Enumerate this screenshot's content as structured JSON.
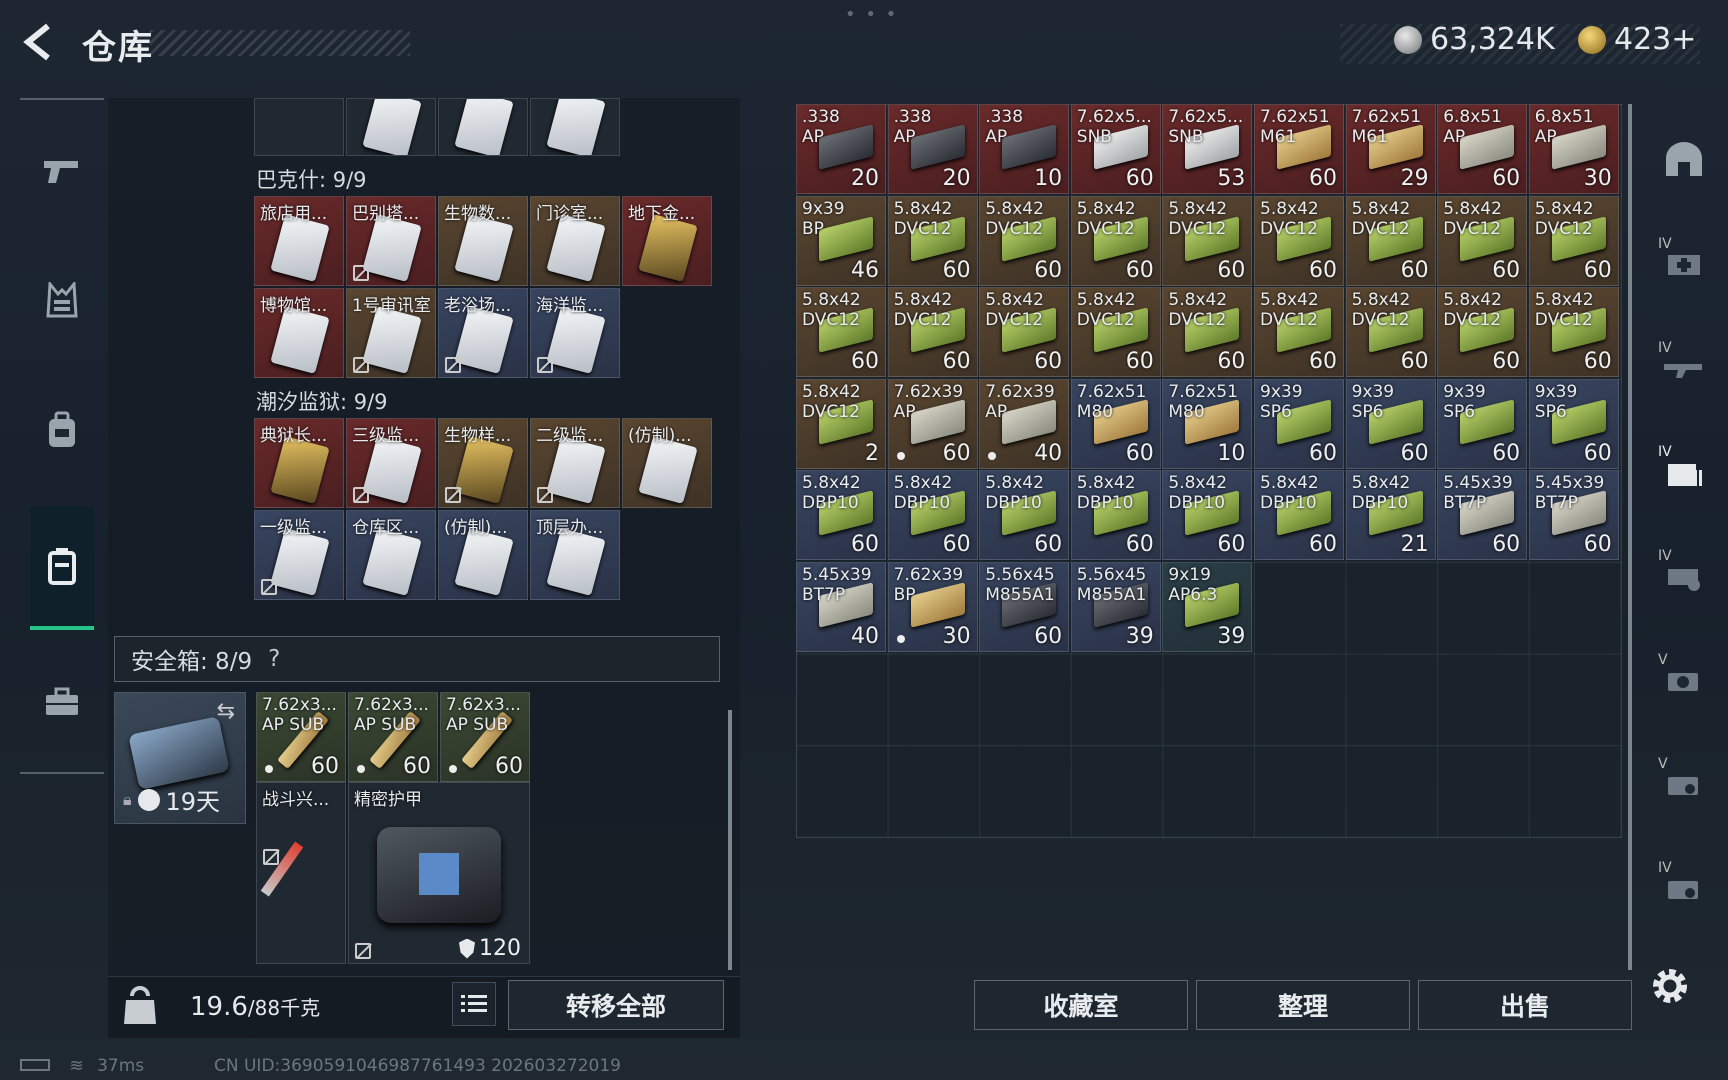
{
  "header": {
    "title": "仓库",
    "currency_primary": "63,324K",
    "currency_secondary": "423+"
  },
  "left_nav": {
    "items": [
      {
        "icon": "pistol-icon"
      },
      {
        "icon": "vest-icon"
      },
      {
        "icon": "backpack-icon"
      },
      {
        "icon": "container-icon",
        "active": true
      },
      {
        "icon": "briefcase-icon"
      }
    ]
  },
  "keycards": {
    "section1_label": "巴克什: 9/9",
    "section1": [
      {
        "name": "旅店用...",
        "color": "red",
        "locked": false
      },
      {
        "name": "巴别塔...",
        "color": "red",
        "locked": true
      },
      {
        "name": "生物数...",
        "color": "brown",
        "locked": false
      },
      {
        "name": "门诊室...",
        "color": "brown",
        "locked": false
      },
      {
        "name": "地下金...",
        "color": "red",
        "locked": false,
        "gold": true
      },
      {
        "name": "博物馆...",
        "color": "red",
        "locked": false
      },
      {
        "name": "1号审讯室",
        "color": "brown",
        "locked": true
      },
      {
        "name": "老浴场...",
        "color": "blue",
        "locked": true
      },
      {
        "name": "海洋监...",
        "color": "blue",
        "locked": true
      }
    ],
    "section2_label": "潮汐监狱: 9/9",
    "section2": [
      {
        "name": "典狱长...",
        "color": "red",
        "locked": false,
        "gold": true
      },
      {
        "name": "三级监...",
        "color": "red",
        "locked": true
      },
      {
        "name": "生物样...",
        "color": "brown",
        "locked": true,
        "gold": true
      },
      {
        "name": "二级监...",
        "color": "brown",
        "locked": true
      },
      {
        "name": "(仿制)...",
        "color": "brown",
        "locked": false
      },
      {
        "name": "一级监...",
        "color": "blue",
        "locked": true
      },
      {
        "name": "仓库区...",
        "color": "blue",
        "locked": false
      },
      {
        "name": "(仿制)...",
        "color": "blue",
        "locked": false
      },
      {
        "name": "顶层办...",
        "color": "blue",
        "locked": false
      }
    ]
  },
  "safe_box": {
    "label": "安全箱: 8/9",
    "help": "?",
    "days": "19天",
    "items": [
      {
        "name": "7.62x3...",
        "sub": "AP SUB",
        "qty": "60"
      },
      {
        "name": "7.62x3...",
        "sub": "AP SUB",
        "qty": "60"
      },
      {
        "name": "7.62x3...",
        "sub": "AP SUB",
        "qty": "60"
      }
    ],
    "injector_name": "战斗兴...",
    "armor_name": "精密护甲",
    "armor_value": "120"
  },
  "weight": {
    "current": "19.6",
    "max": "/88千克"
  },
  "buttons": {
    "transfer_all": "转移全部",
    "collection": "收藏室",
    "organize": "整理",
    "sell": "出售"
  },
  "stash_items": [
    {
      "l1": ".338",
      "l2": "AP",
      "qty": "20",
      "bg": "red",
      "img": "dark"
    },
    {
      "l1": ".338",
      "l2": "AP",
      "qty": "20",
      "bg": "red",
      "img": "dark"
    },
    {
      "l1": ".338",
      "l2": "AP",
      "qty": "10",
      "bg": "red",
      "img": "dark"
    },
    {
      "l1": "7.62x5...",
      "l2": "SNB",
      "qty": "60",
      "bg": "red",
      "img": "white"
    },
    {
      "l1": "7.62x5...",
      "l2": "SNB",
      "qty": "53",
      "bg": "red",
      "img": "white"
    },
    {
      "l1": "7.62x51",
      "l2": "M61",
      "qty": "60",
      "bg": "red",
      "img": "tan"
    },
    {
      "l1": "7.62x51",
      "l2": "M61",
      "qty": "29",
      "bg": "red",
      "img": "tan"
    },
    {
      "l1": "6.8x51",
      "l2": "AP",
      "qty": "60",
      "bg": "red",
      "img": "gray"
    },
    {
      "l1": "6.8x51",
      "l2": "AP",
      "qty": "30",
      "bg": "red",
      "img": "gray"
    },
    {
      "l1": "9x39",
      "l2": "BP",
      "qty": "46",
      "bg": "brown",
      "img": "green"
    },
    {
      "l1": "5.8x42",
      "l2": "DVC12",
      "qty": "60",
      "bg": "brown",
      "img": "green"
    },
    {
      "l1": "5.8x42",
      "l2": "DVC12",
      "qty": "60",
      "bg": "brown",
      "img": "green"
    },
    {
      "l1": "5.8x42",
      "l2": "DVC12",
      "qty": "60",
      "bg": "brown",
      "img": "green"
    },
    {
      "l1": "5.8x42",
      "l2": "DVC12",
      "qty": "60",
      "bg": "brown",
      "img": "green"
    },
    {
      "l1": "5.8x42",
      "l2": "DVC12",
      "qty": "60",
      "bg": "brown",
      "img": "green"
    },
    {
      "l1": "5.8x42",
      "l2": "DVC12",
      "qty": "60",
      "bg": "brown",
      "img": "green"
    },
    {
      "l1": "5.8x42",
      "l2": "DVC12",
      "qty": "60",
      "bg": "brown",
      "img": "green"
    },
    {
      "l1": "5.8x42",
      "l2": "DVC12",
      "qty": "60",
      "bg": "brown",
      "img": "green"
    },
    {
      "l1": "5.8x42",
      "l2": "DVC12",
      "qty": "60",
      "bg": "brown",
      "img": "green"
    },
    {
      "l1": "5.8x42",
      "l2": "DVC12",
      "qty": "60",
      "bg": "brown",
      "img": "green"
    },
    {
      "l1": "5.8x42",
      "l2": "DVC12",
      "qty": "60",
      "bg": "brown",
      "img": "green"
    },
    {
      "l1": "5.8x42",
      "l2": "DVC12",
      "qty": "60",
      "bg": "brown",
      "img": "green"
    },
    {
      "l1": "5.8x42",
      "l2": "DVC12",
      "qty": "60",
      "bg": "brown",
      "img": "green"
    },
    {
      "l1": "5.8x42",
      "l2": "DVC12",
      "qty": "60",
      "bg": "brown",
      "img": "green"
    },
    {
      "l1": "5.8x42",
      "l2": "DVC12",
      "qty": "60",
      "bg": "brown",
      "img": "green"
    },
    {
      "l1": "5.8x42",
      "l2": "DVC12",
      "qty": "60",
      "bg": "brown",
      "img": "green"
    },
    {
      "l1": "5.8x42",
      "l2": "DVC12",
      "qty": "60",
      "bg": "brown",
      "img": "green"
    },
    {
      "l1": "5.8x42",
      "l2": "DVC12",
      "qty": "2",
      "bg": "brown",
      "img": "green"
    },
    {
      "l1": "7.62x39",
      "l2": "AP",
      "qty": "60",
      "bg": "brown",
      "img": "gray",
      "dot": true
    },
    {
      "l1": "7.62x39",
      "l2": "AP",
      "qty": "40",
      "bg": "brown",
      "img": "gray",
      "dot": true
    },
    {
      "l1": "7.62x51",
      "l2": "M80",
      "qty": "60",
      "bg": "blue",
      "img": "tan"
    },
    {
      "l1": "7.62x51",
      "l2": "M80",
      "qty": "10",
      "bg": "blue",
      "img": "tan"
    },
    {
      "l1": "9x39",
      "l2": "SP6",
      "qty": "60",
      "bg": "blue",
      "img": "green"
    },
    {
      "l1": "9x39",
      "l2": "SP6",
      "qty": "60",
      "bg": "blue",
      "img": "green"
    },
    {
      "l1": "9x39",
      "l2": "SP6",
      "qty": "60",
      "bg": "blue",
      "img": "green"
    },
    {
      "l1": "9x39",
      "l2": "SP6",
      "qty": "60",
      "bg": "blue",
      "img": "green"
    },
    {
      "l1": "5.8x42",
      "l2": "DBP10",
      "qty": "60",
      "bg": "blue",
      "img": "green"
    },
    {
      "l1": "5.8x42",
      "l2": "DBP10",
      "qty": "60",
      "bg": "blue",
      "img": "green"
    },
    {
      "l1": "5.8x42",
      "l2": "DBP10",
      "qty": "60",
      "bg": "blue",
      "img": "green"
    },
    {
      "l1": "5.8x42",
      "l2": "DBP10",
      "qty": "60",
      "bg": "blue",
      "img": "green"
    },
    {
      "l1": "5.8x42",
      "l2": "DBP10",
      "qty": "60",
      "bg": "blue",
      "img": "green"
    },
    {
      "l1": "5.8x42",
      "l2": "DBP10",
      "qty": "60",
      "bg": "blue",
      "img": "green"
    },
    {
      "l1": "5.8x42",
      "l2": "DBP10",
      "qty": "21",
      "bg": "blue",
      "img": "green"
    },
    {
      "l1": "5.45x39",
      "l2": "BT7P",
      "qty": "60",
      "bg": "blue",
      "img": "gray"
    },
    {
      "l1": "5.45x39",
      "l2": "BT7P",
      "qty": "60",
      "bg": "blue",
      "img": "gray"
    },
    {
      "l1": "5.45x39",
      "l2": "BT7P",
      "qty": "40",
      "bg": "blue",
      "img": "gray"
    },
    {
      "l1": "7.62x39",
      "l2": "BP",
      "qty": "30",
      "bg": "blue",
      "img": "tan",
      "dot": true
    },
    {
      "l1": "5.56x45",
      "l2": "M855A1",
      "qty": "60",
      "bg": "blue",
      "img": "dark"
    },
    {
      "l1": "5.56x45",
      "l2": "M855A1",
      "qty": "39",
      "bg": "blue",
      "img": "dark"
    },
    {
      "l1": "9x19",
      "l2": "AP6.3",
      "qty": "39",
      "bg": "teal",
      "img": "green"
    }
  ],
  "footer": {
    "ping": "37ms",
    "uid": "CN UID:3690591046987761493 202603272019"
  },
  "colors": {
    "accent_green": "#27c48a"
  }
}
